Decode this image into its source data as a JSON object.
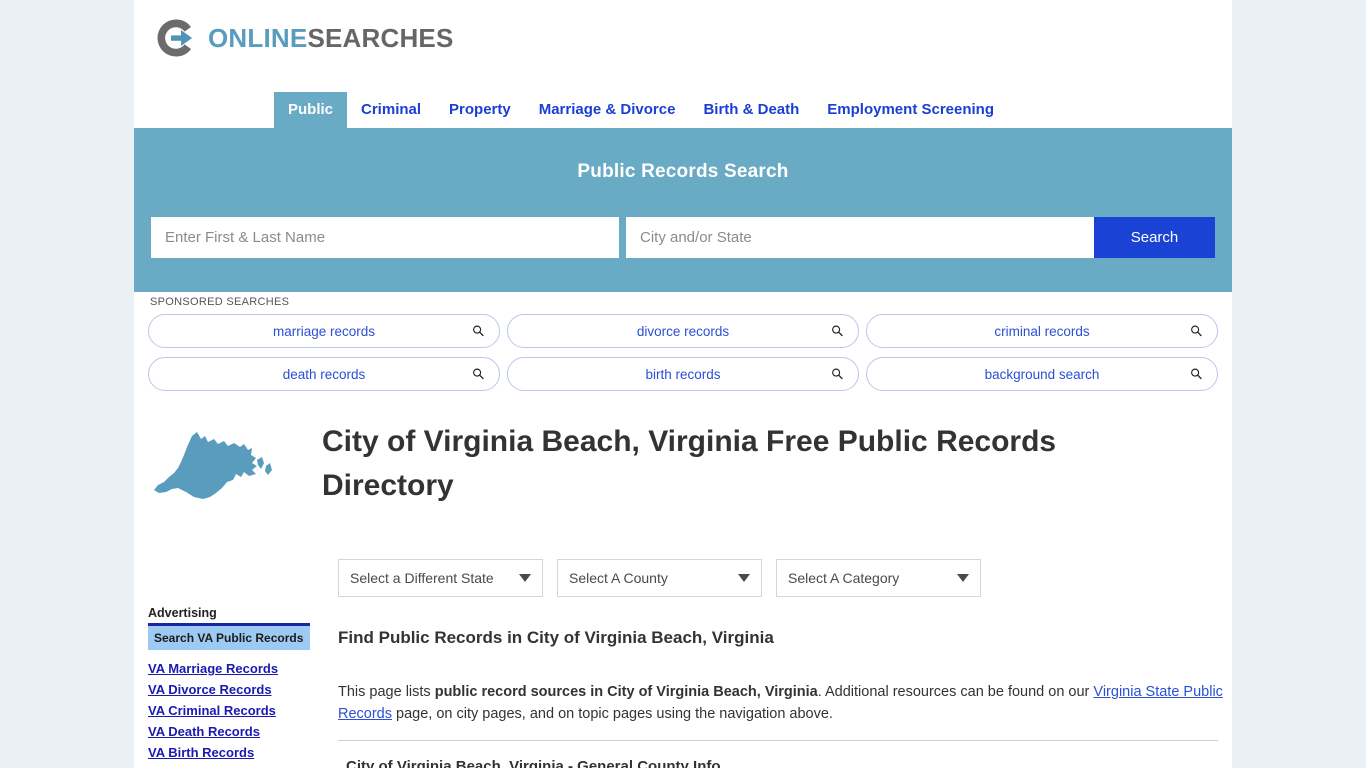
{
  "brand": {
    "name_part1": "ONLINE",
    "name_part2": "SEARCHES",
    "logo_icon": "circle-arrow-icon",
    "accent_blue": "#5a9cbd",
    "accent_gray": "#666666"
  },
  "nav": {
    "tabs": [
      {
        "label": "Public",
        "active": true
      },
      {
        "label": "Criminal",
        "active": false
      },
      {
        "label": "Property",
        "active": false
      },
      {
        "label": "Marriage & Divorce",
        "active": false
      },
      {
        "label": "Birth & Death",
        "active": false
      },
      {
        "label": "Employment Screening",
        "active": false
      }
    ]
  },
  "hero": {
    "title": "Public Records Search",
    "background_color": "#69aac4",
    "name_placeholder": "Enter First & Last Name",
    "name_value": "",
    "place_placeholder": "City and/or State",
    "place_value": "",
    "search_label": "Search",
    "search_button_color": "#1a43d6"
  },
  "sponsored": {
    "label": "SPONSORED SEARCHES",
    "items": [
      {
        "label": "marriage records",
        "icon": "search-icon"
      },
      {
        "label": "divorce records",
        "icon": "search-icon"
      },
      {
        "label": "criminal records",
        "icon": "search-icon"
      },
      {
        "label": "death records",
        "icon": "search-icon"
      },
      {
        "label": "birth records",
        "icon": "search-icon"
      },
      {
        "label": "background search",
        "icon": "search-icon"
      }
    ]
  },
  "main": {
    "state_map_icon": "virginia-state-map-icon",
    "state_map_color": "#5a9cbd",
    "title": "City of Virginia Beach, Virginia Free Public Records Directory",
    "selects": [
      {
        "name": "state",
        "value": "Select a Different State"
      },
      {
        "name": "county",
        "value": "Select A County"
      },
      {
        "name": "category",
        "value": "Select A Category"
      }
    ],
    "find_heading": "Find Public Records in City of Virginia Beach, Virginia",
    "paragraph": {
      "lead": "This page lists ",
      "bold": "public record sources in City of Virginia Beach, Virginia",
      "mid": ". Additional resources can be found on our ",
      "link": "Virginia State Public Records",
      "tail": " page, on city pages, and on topic pages using the navigation above."
    },
    "section_heading": "City of Virginia Beach, Virginia - General County Info"
  },
  "sidebar": {
    "advertising_label": "Advertising",
    "ad_heading": "Search VA Public Records",
    "links": [
      "VA Marriage Records",
      "VA Divorce Records",
      "VA Criminal Records",
      "VA Death Records",
      "VA Birth Records"
    ]
  }
}
